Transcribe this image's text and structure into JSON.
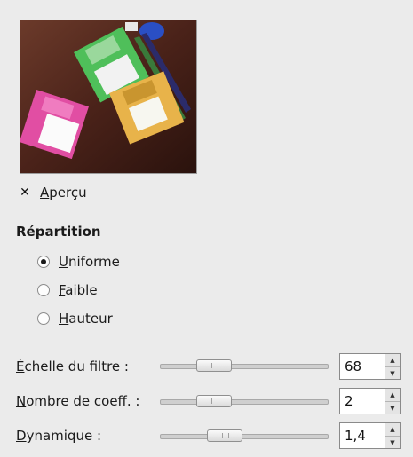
{
  "preview": {
    "checkbox_mark": "✕",
    "label": "Aperçu",
    "checked": true
  },
  "repartition": {
    "title": "Répartition",
    "options": [
      {
        "label": "Uniforme",
        "selected": true
      },
      {
        "label": "Faible",
        "selected": false
      },
      {
        "label": "Hauteur",
        "selected": false
      }
    ]
  },
  "params": [
    {
      "label": "Échelle du filtre :",
      "value": "68",
      "level": 0.27
    },
    {
      "label": "Nombre de coeff. :",
      "value": "2",
      "level": 0.27
    },
    {
      "label": "Dynamique :",
      "value": "1,4",
      "level": 0.35
    }
  ],
  "icons": {
    "spin_up": "▲",
    "spin_down": "▼"
  }
}
